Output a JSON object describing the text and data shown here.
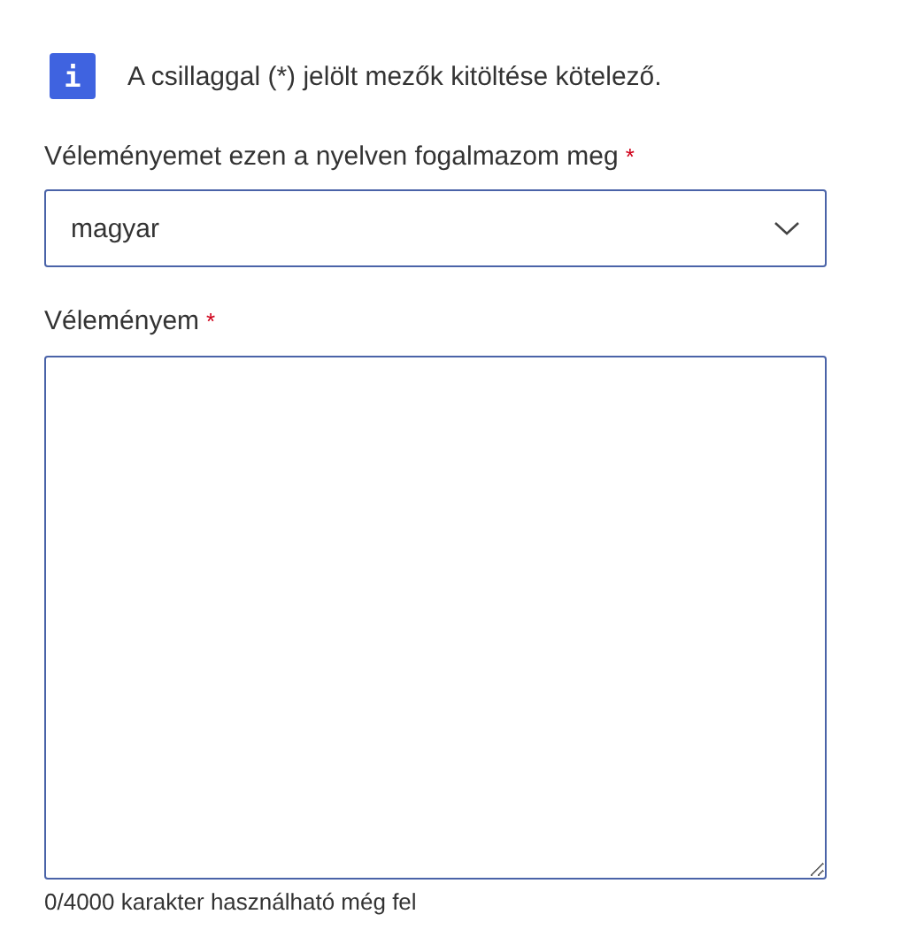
{
  "notice": {
    "icon": "i",
    "text": "A csillaggal (*) jelölt mezők kitöltése kötelező."
  },
  "language_field": {
    "label": "Véleményemet ezen a nyelven fogalmazom meg",
    "required_mark": "*",
    "value": "magyar"
  },
  "opinion_field": {
    "label": "Véleményem",
    "required_mark": "*",
    "counter": "0/4000 karakter használható még fel"
  }
}
